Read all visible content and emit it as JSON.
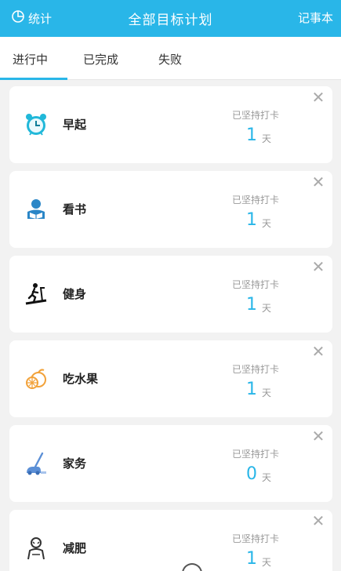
{
  "header": {
    "stats_label": "统计",
    "title": "全部目标计划",
    "notebook_label": "记事本",
    "bg_color": "#29b6e8"
  },
  "tabs": [
    {
      "label": "进行中",
      "active": true
    },
    {
      "label": "已完成",
      "active": false
    },
    {
      "label": "失败",
      "active": false
    }
  ],
  "goals": [
    {
      "name": "早起",
      "icon": "alarm-clock-icon",
      "streak_label": "已坚持打卡",
      "days": "1",
      "unit": "天"
    },
    {
      "name": "看书",
      "icon": "reading-icon",
      "streak_label": "已坚持打卡",
      "days": "1",
      "unit": "天"
    },
    {
      "name": "健身",
      "icon": "treadmill-icon",
      "streak_label": "已坚持打卡",
      "days": "1",
      "unit": "天"
    },
    {
      "name": "吃水果",
      "icon": "fruit-icon",
      "streak_label": "已坚持打卡",
      "days": "1",
      "unit": "天"
    },
    {
      "name": "家务",
      "icon": "vacuum-icon",
      "streak_label": "已坚持打卡",
      "days": "0",
      "unit": "天"
    },
    {
      "name": "减肥",
      "icon": "person-icon",
      "streak_label": "已坚持打卡",
      "days": "1",
      "unit": "天"
    }
  ],
  "close_glyph": "✕"
}
